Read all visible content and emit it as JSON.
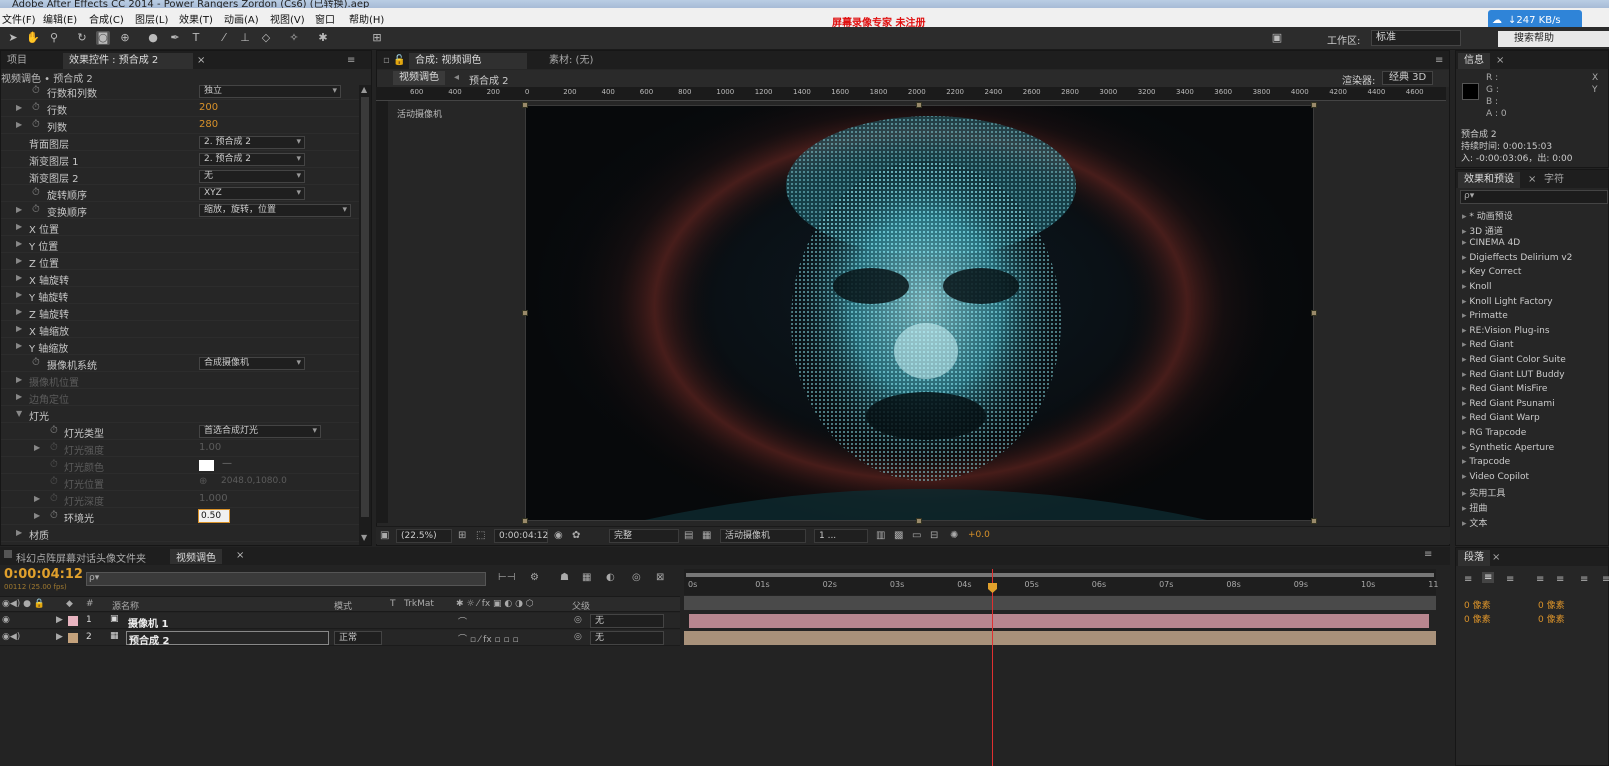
{
  "app": {
    "title": "Adobe After Effects CC 2014 - Power Rangers Zordon (Cs6) (已转换).aep",
    "recorder_watermark": "屏幕录像专家  未注册",
    "speed_badge": "↓247 KB/s"
  },
  "menu": [
    "文件(F)",
    "编辑(E)",
    "合成(C)",
    "图层(L)",
    "效果(T)",
    "动画(A)",
    "视图(V)",
    "窗口",
    "帮助(H)"
  ],
  "toolbar": {
    "workspace_label": "工作区:",
    "workspace_value": "标准",
    "search_help": "搜索帮助"
  },
  "effects_panel": {
    "tab_project": "项目",
    "tab_effects": "效果控件 : 预合成 2",
    "breadcrumb": "视频调色 • 预合成 2",
    "rows": [
      {
        "label": "行数和列数",
        "value": "独立",
        "type": "dropdown"
      },
      {
        "label": "行数",
        "value": "200",
        "type": "number"
      },
      {
        "label": "列数",
        "value": "280",
        "type": "number"
      },
      {
        "label": "背面图层",
        "value": "2. 预合成 2",
        "type": "dropdown"
      },
      {
        "label": "渐变图层 1",
        "value": "2. 预合成 2",
        "type": "dropdown"
      },
      {
        "label": "渐变图层 2",
        "value": "无",
        "type": "dropdown"
      },
      {
        "label": "旋转顺序",
        "value": "XYZ",
        "type": "dropdown"
      },
      {
        "label": "变换顺序",
        "value": "缩放，旋转，位置",
        "type": "dropdown"
      },
      {
        "label": "X 位置"
      },
      {
        "label": "Y 位置"
      },
      {
        "label": "Z 位置"
      },
      {
        "label": "X 轴旋转"
      },
      {
        "label": "Y 轴旋转"
      },
      {
        "label": "Z 轴旋转"
      },
      {
        "label": "X 轴缩放"
      },
      {
        "label": "Y 轴缩放"
      },
      {
        "label": "摄像机系统",
        "value": "合成摄像机",
        "type": "dropdown"
      },
      {
        "label": "摄像机位置"
      },
      {
        "label": "边角定位"
      },
      {
        "label": "灯光"
      },
      {
        "label": "灯光类型",
        "value": "首选合成灯光",
        "type": "dropdown"
      },
      {
        "label": "灯光强度",
        "value": "1.00",
        "type": "number"
      },
      {
        "label": "灯光颜色"
      },
      {
        "label": "灯光位置",
        "value": "2048.0,1080.0",
        "type": "number"
      },
      {
        "label": "灯光深度",
        "value": "1.000",
        "type": "number"
      },
      {
        "label": "环境光",
        "value": "0.50",
        "type": "number"
      },
      {
        "label": "材质"
      }
    ]
  },
  "viewer": {
    "tab_comp": "合成: 视频调色",
    "tab_footage": "素材: (无)",
    "flow_current": "视频调色",
    "flow_child": "预合成 2",
    "renderer_label": "渲染器:",
    "renderer_value": "经典 3D",
    "active_camera_label": "活动摄像机",
    "ruler_ticks": [
      "600",
      "400",
      "200",
      "0",
      "200",
      "400",
      "600",
      "800",
      "1000",
      "1200",
      "1400",
      "1600",
      "1800",
      "2000",
      "2200",
      "2400",
      "2600",
      "2800",
      "3000",
      "3200",
      "3400",
      "3600",
      "3800",
      "4000",
      "4200",
      "4400",
      "4600"
    ],
    "zoom": "(22.5%)",
    "timecode": "0:00:04:12",
    "quality": "完整",
    "view_camera": "活动摄像机",
    "view_count": "1 ...",
    "exposure": "+0.0"
  },
  "info_panel": {
    "tab": "信息",
    "r": "R :",
    "g": "G :",
    "b": "B :",
    "a": "A : 0",
    "x": "X",
    "y": "Y",
    "comp_name": "预合成 2",
    "duration": "持续时间: 0:00:15:03",
    "in_out": "入: -0:00:03:06，出: 0:00"
  },
  "effects_presets": {
    "tab": "效果和预设",
    "tab2": "字符",
    "search_placeholder": "ρ▾",
    "items": [
      "* 动画预设",
      "3D 通道",
      "CINEMA 4D",
      "Digieffects Delirium v2",
      "Key Correct",
      "Knoll",
      "Knoll Light Factory",
      "Primatte",
      "RE:Vision Plug-ins",
      "Red Giant",
      "Red Giant Color Suite",
      "Red Giant LUT Buddy",
      "Red Giant MisFire",
      "Red Giant Psunami",
      "Red Giant Warp",
      "RG Trapcode",
      "Synthetic Aperture",
      "Trapcode",
      "Video Copilot",
      "实用工具",
      "扭曲",
      "文本"
    ]
  },
  "paragraph_panel": {
    "tab": "段落",
    "indent1": "0 像素",
    "indent2": "0 像素",
    "indent3": "0 像素",
    "indent4": "0 像素"
  },
  "timeline": {
    "tab1": "科幻点阵屏幕对话头像文件夹",
    "tab2": "视频调色",
    "current_time": "0:00:04:12",
    "frame_info": "00112 (25.00 fps)",
    "col_source": "源名称",
    "col_mode": "模式",
    "col_t": "T",
    "col_trkmat": "TrkMat",
    "col_parent": "父级",
    "time_ticks": [
      "0s",
      "01s",
      "02s",
      "03s",
      "04s",
      "05s",
      "06s",
      "07s",
      "08s",
      "09s",
      "10s",
      "11"
    ],
    "layers": [
      {
        "num": "1",
        "name": "摄像机 1",
        "mode": "",
        "parent": "无",
        "color": "#e8b4c0",
        "bar": "#b8868f"
      },
      {
        "num": "2",
        "name": "预合成 2",
        "mode": "正常",
        "parent": "无",
        "color": "#c4a27c",
        "bar": "#a8917a"
      }
    ]
  }
}
